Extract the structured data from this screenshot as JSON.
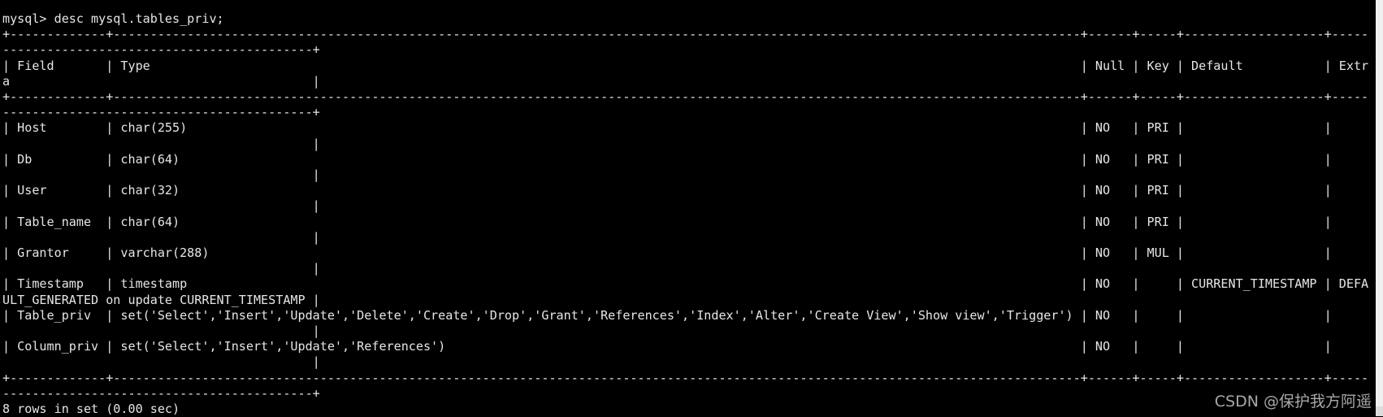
{
  "terminal": {
    "prompt": "mysql> ",
    "command": "desc mysql.tables_priv;",
    "wrap_columns": 185,
    "columns": [
      "Field",
      "Type",
      "Null",
      "Key",
      "Default",
      "Extra"
    ],
    "rows": [
      [
        "Host",
        "char(255)",
        "NO",
        "PRI",
        "",
        ""
      ],
      [
        "Db",
        "char(64)",
        "NO",
        "PRI",
        "",
        ""
      ],
      [
        "User",
        "char(32)",
        "NO",
        "PRI",
        "",
        ""
      ],
      [
        "Table_name",
        "char(64)",
        "NO",
        "PRI",
        "",
        ""
      ],
      [
        "Grantor",
        "varchar(288)",
        "NO",
        "MUL",
        "",
        ""
      ],
      [
        "Timestamp",
        "timestamp",
        "NO",
        "",
        "CURRENT_TIMESTAMP",
        "DEFAULT_GENERATED on update CURRENT_TIMESTAMP"
      ],
      [
        "Table_priv",
        "set('Select','Insert','Update','Delete','Create','Drop','Grant','References','Index','Alter','Create View','Show view','Trigger')",
        "NO",
        "",
        "",
        ""
      ],
      [
        "Column_priv",
        "set('Select','Insert','Update','References')",
        "NO",
        "",
        "",
        ""
      ]
    ],
    "summary": "8 rows in set (0.00 sec)"
  },
  "watermark": "CSDN @保护我方阿遥",
  "colors": {
    "background": "#000000",
    "text": "#e6e6e6",
    "watermark": "#a8a8a8"
  }
}
